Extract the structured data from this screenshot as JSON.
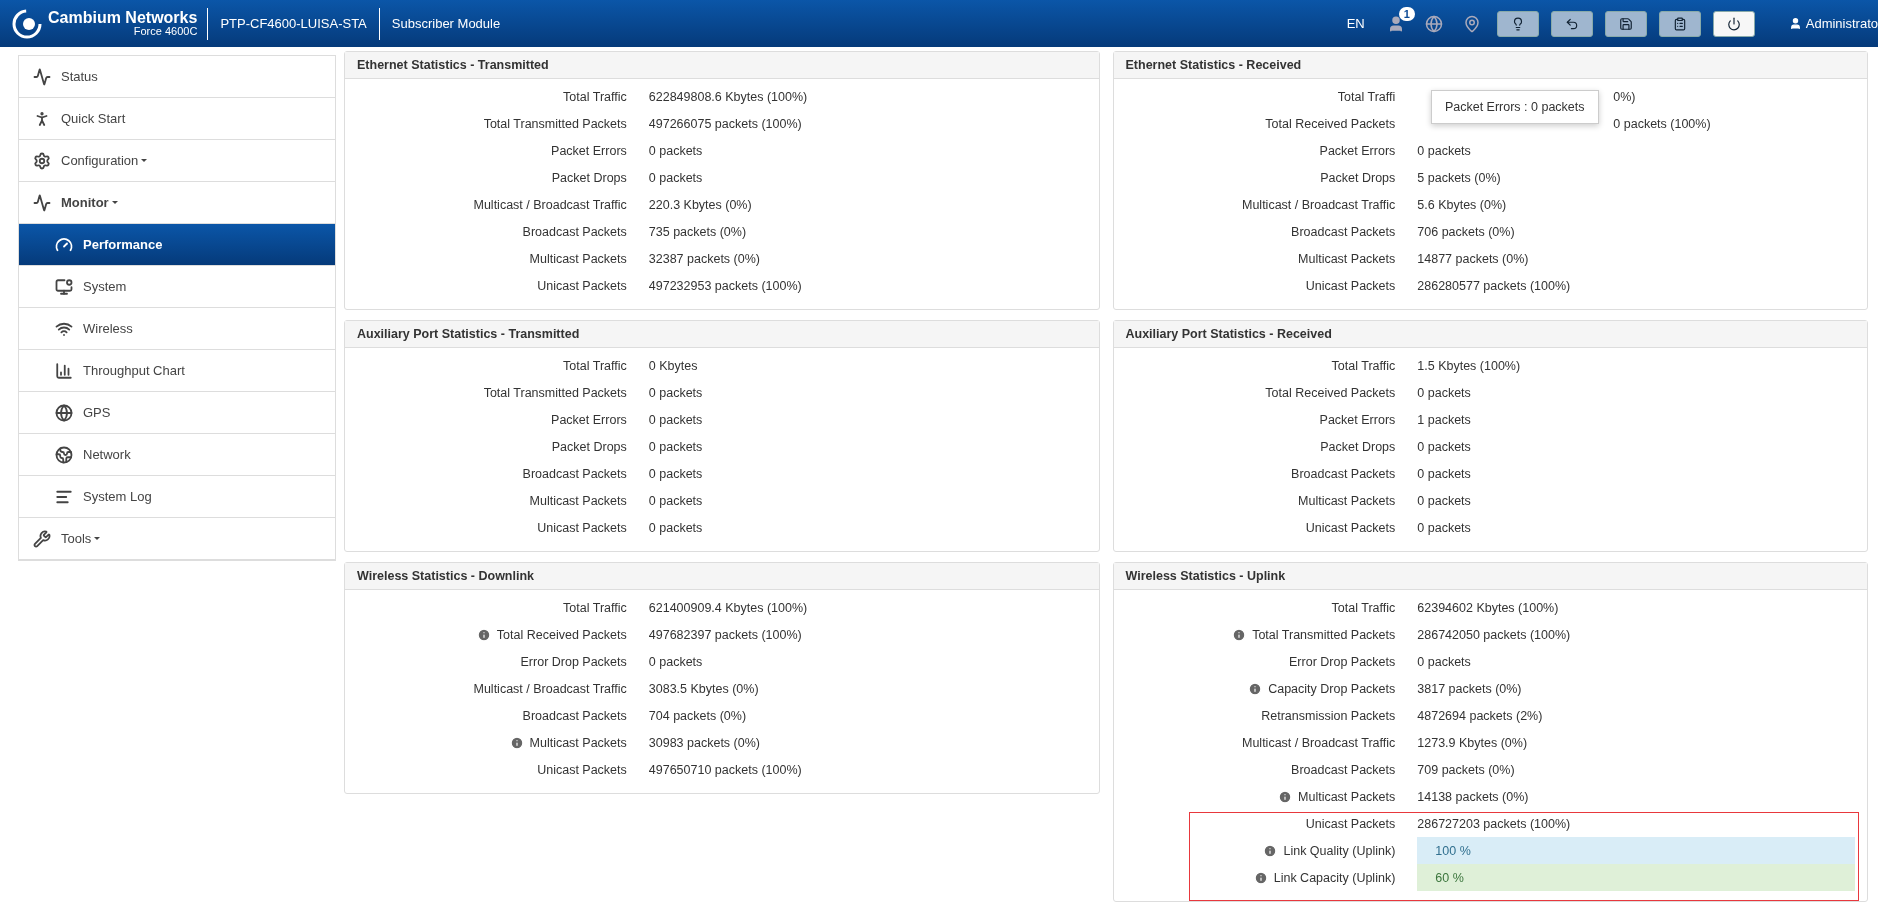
{
  "header": {
    "brand": "Cambium Networks",
    "model": "Force 4600C",
    "device": "PTP-CF4600-LUISA-STA",
    "mode": "Subscriber Module",
    "language": "EN",
    "notification_count": "1",
    "user": "Administrato"
  },
  "sidebar": {
    "items": [
      {
        "label": "Status",
        "selected": false
      },
      {
        "label": "Quick Start",
        "selected": false
      },
      {
        "label": "Configuration",
        "selected": false,
        "expanded": false
      },
      {
        "label": "Monitor",
        "selected": false,
        "expanded": true,
        "children": [
          {
            "label": "Performance",
            "selected": true
          },
          {
            "label": "System",
            "selected": false
          },
          {
            "label": "Wireless",
            "selected": false
          },
          {
            "label": "Throughput Chart",
            "selected": false
          },
          {
            "label": "GPS",
            "selected": false
          },
          {
            "label": "Network",
            "selected": false
          },
          {
            "label": "System Log",
            "selected": false
          }
        ]
      },
      {
        "label": "Tools",
        "selected": false,
        "expanded": false
      }
    ]
  },
  "panels": [
    {
      "title": "Ethernet Statistics - Transmitted",
      "rows": [
        {
          "label": "Total Traffic",
          "value": "622849808.6 Kbytes (100%)",
          "info": false
        },
        {
          "label": "Total Transmitted Packets",
          "value": "497266075 packets (100%)",
          "info": false
        },
        {
          "label": "Packet Errors",
          "value": "0 packets",
          "info": false
        },
        {
          "label": "Packet Drops",
          "value": "0 packets",
          "info": false
        },
        {
          "label": "Multicast / Broadcast Traffic",
          "value": "220.3 Kbytes (0%)",
          "info": false
        },
        {
          "label": "Broadcast Packets",
          "value": "735 packets (0%)",
          "info": false
        },
        {
          "label": "Multicast Packets",
          "value": "32387 packets (0%)",
          "info": false
        },
        {
          "label": "Unicast Packets",
          "value": "497232953 packets (100%)",
          "info": false
        }
      ]
    },
    {
      "title": "Ethernet Statistics - Received",
      "tooltip": "Packet Errors : 0 packets",
      "rows": [
        {
          "label": "Total Traffi",
          "value": "0%)",
          "info": false,
          "hidden_part": true
        },
        {
          "label": "Total Received Packets",
          "value": "0 packets (100%)",
          "info": false,
          "hidden_part": true
        },
        {
          "label": "Packet Errors",
          "value": "0 packets",
          "info": false
        },
        {
          "label": "Packet Drops",
          "value": "5 packets (0%)",
          "info": false
        },
        {
          "label": "Multicast / Broadcast Traffic",
          "value": "5.6 Kbytes (0%)",
          "info": false
        },
        {
          "label": "Broadcast Packets",
          "value": "706 packets (0%)",
          "info": false
        },
        {
          "label": "Multicast Packets",
          "value": "14877 packets (0%)",
          "info": false
        },
        {
          "label": "Unicast Packets",
          "value": "286280577 packets (100%)",
          "info": false
        }
      ]
    },
    {
      "title": "Auxiliary Port Statistics - Transmitted",
      "rows": [
        {
          "label": "Total Traffic",
          "value": "0 Kbytes",
          "info": false
        },
        {
          "label": "Total Transmitted Packets",
          "value": "0 packets",
          "info": false
        },
        {
          "label": "Packet Errors",
          "value": "0 packets",
          "info": false
        },
        {
          "label": "Packet Drops",
          "value": "0 packets",
          "info": false
        },
        {
          "label": "Broadcast Packets",
          "value": "0 packets",
          "info": false
        },
        {
          "label": "Multicast Packets",
          "value": "0 packets",
          "info": false
        },
        {
          "label": "Unicast Packets",
          "value": "0 packets",
          "info": false
        }
      ]
    },
    {
      "title": "Auxiliary Port Statistics - Received",
      "rows": [
        {
          "label": "Total Traffic",
          "value": "1.5 Kbytes (100%)",
          "info": false
        },
        {
          "label": "Total Received Packets",
          "value": "0 packets",
          "info": false
        },
        {
          "label": "Packet Errors",
          "value": "1 packets",
          "info": false
        },
        {
          "label": "Packet Drops",
          "value": "0 packets",
          "info": false
        },
        {
          "label": "Broadcast Packets",
          "value": "0 packets",
          "info": false
        },
        {
          "label": "Multicast Packets",
          "value": "0 packets",
          "info": false
        },
        {
          "label": "Unicast Packets",
          "value": "0 packets",
          "info": false
        }
      ]
    },
    {
      "title": "Wireless Statistics - Downlink",
      "rows": [
        {
          "label": "Total Traffic",
          "value": "621400909.4 Kbytes (100%)",
          "info": false
        },
        {
          "label": "Total Received Packets",
          "value": "497682397 packets (100%)",
          "info": true
        },
        {
          "label": "Error Drop Packets",
          "value": "0 packets",
          "info": false
        },
        {
          "label": "Multicast / Broadcast Traffic",
          "value": "3083.5 Kbytes (0%)",
          "info": false
        },
        {
          "label": "Broadcast Packets",
          "value": "704 packets (0%)",
          "info": false
        },
        {
          "label": "Multicast Packets",
          "value": "30983 packets (0%)",
          "info": true
        },
        {
          "label": "Unicast Packets",
          "value": "497650710 packets (100%)",
          "info": false
        }
      ]
    },
    {
      "title": "Wireless Statistics - Uplink",
      "rows": [
        {
          "label": "Total Traffic",
          "value": "62394602 Kbytes (100%)",
          "info": false
        },
        {
          "label": "Total Transmitted Packets",
          "value": "286742050 packets (100%)",
          "info": true
        },
        {
          "label": "Error Drop Packets",
          "value": "0 packets",
          "info": false
        },
        {
          "label": "Capacity Drop Packets",
          "value": "3817 packets (0%)",
          "info": true
        },
        {
          "label": "Retransmission Packets",
          "value": "4872694 packets (2%)",
          "info": false
        },
        {
          "label": "Multicast / Broadcast Traffic",
          "value": "1273.9 Kbytes (0%)",
          "info": false
        },
        {
          "label": "Broadcast Packets",
          "value": "709 packets (0%)",
          "info": false
        },
        {
          "label": "Multicast Packets",
          "value": "14138 packets (0%)",
          "info": true
        },
        {
          "label": "Unicast Packets",
          "value": "286727203 packets (100%)",
          "info": false,
          "highlighted": true
        },
        {
          "label": "Link Quality (Uplink)",
          "value": "100 %",
          "info": true,
          "color": "#d9edf7",
          "highlighted": true
        },
        {
          "label": "Link Capacity (Uplink)",
          "value": "60 %",
          "info": true,
          "color": "#dff0d8",
          "highlighted": true
        }
      ]
    }
  ]
}
